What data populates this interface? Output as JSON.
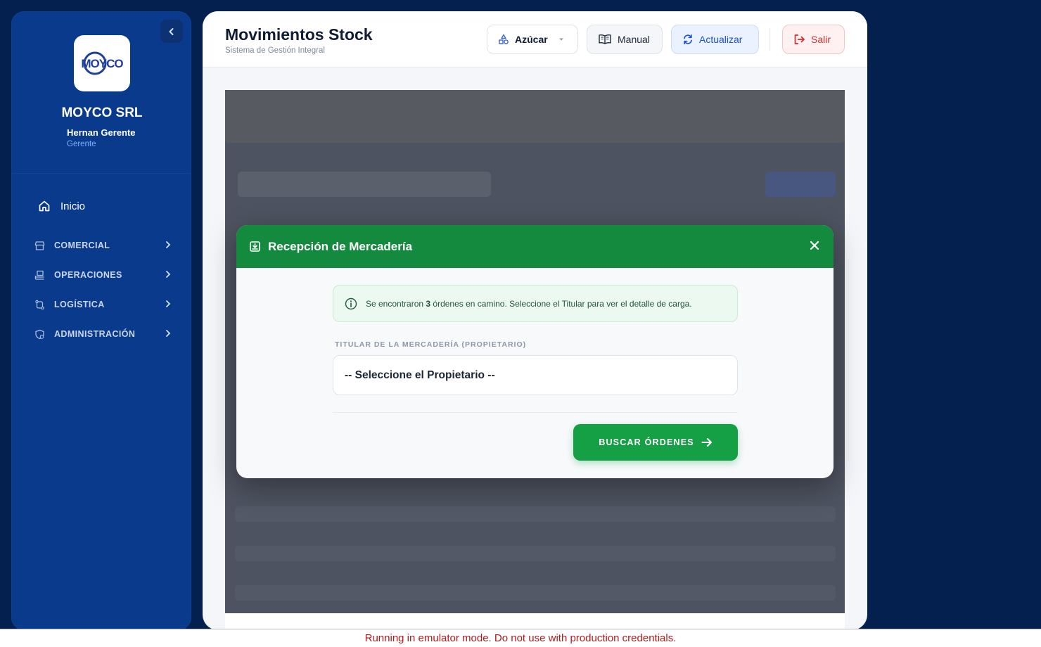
{
  "sidebar": {
    "logo_text": "MOYCO",
    "brand": "MOYCO SRL",
    "user_name": "Hernan Gerente",
    "user_role": "Gerente",
    "home_label": "Inicio",
    "items": [
      {
        "label": "COMERCIAL",
        "icon": "store-icon"
      },
      {
        "label": "OPERACIONES",
        "icon": "operations-icon"
      },
      {
        "label": "LOGÍSTICA",
        "icon": "route-icon"
      },
      {
        "label": "ADMINISTRACIÓN",
        "icon": "admin-icon"
      }
    ]
  },
  "header": {
    "title": "Movimientos Stock",
    "subtitle": "Sistema de Gestión Integral",
    "product_selector": "Azúcar",
    "manual_label": "Manual",
    "refresh_label": "Actualizar",
    "exit_label": "Salir"
  },
  "modal": {
    "title": "Recepción de Mercadería",
    "alert_prefix": "Se encontraron ",
    "alert_count": "3",
    "alert_suffix": " órdenes en camino. Seleccione el Titular para ver el detalle de carga.",
    "field_label": "TITULAR DE LA MERCADERÍA (PROPIETARIO)",
    "select_value": "-- Seleccione el Propietario --",
    "button_label": "BUSCAR ÓRDENES"
  },
  "colors": {
    "sidebar_bg": "#0a3a8c",
    "modal_header": "#138a3d",
    "primary_button": "#16a045",
    "accent_blue": "#1c4fd4",
    "danger": "#d92b2b"
  },
  "footer_banner": "Running in emulator mode. Do not use with production credentials."
}
